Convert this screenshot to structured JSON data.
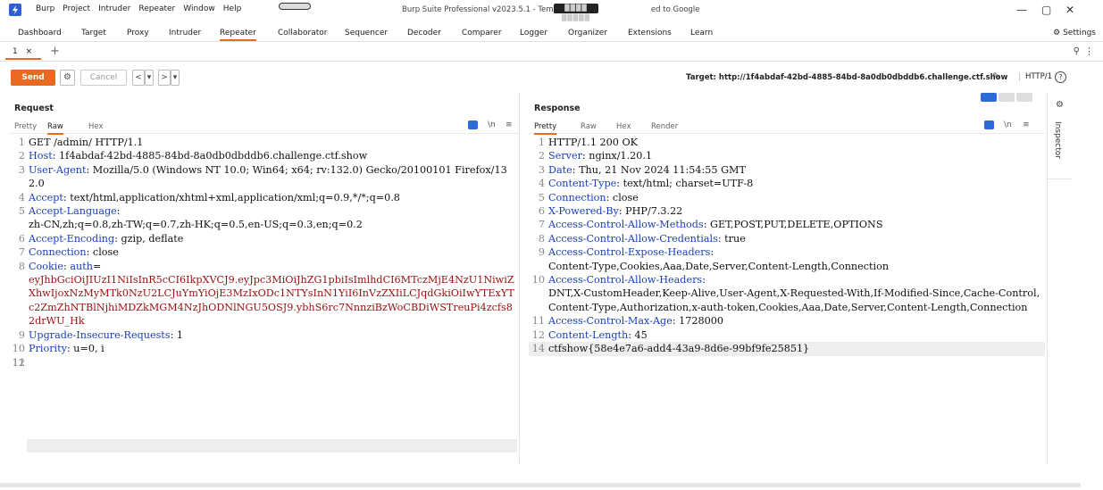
{
  "window": {
    "title": "Burp Suite Professional v2023.5.1 - Temporary Project - licensed to Google",
    "title_visible_left": "Burp Suite Professional v2023.5.1 - Tempora",
    "title_visible_right": "ed to Google",
    "overlay_text": "████ █████",
    "menu": [
      "Burp",
      "Project",
      "Intruder",
      "Repeater",
      "Window",
      "Help"
    ],
    "minimize": "—",
    "maximize": "▢",
    "close": "✕"
  },
  "tool_tabs": [
    "Dashboard",
    "Target",
    "Proxy",
    "Intruder",
    "Repeater",
    "Collaborator",
    "Sequencer",
    "Decoder",
    "Comparer",
    "Logger",
    "Organizer",
    "Extensions",
    "Learn"
  ],
  "active_tool_tab": "Repeater",
  "settings_label": "Settings",
  "repeater_tab": {
    "label": "1",
    "close": "×",
    "add": "+"
  },
  "toolbar": {
    "send": "Send",
    "cancel": "Cancel",
    "back": "<",
    "back_menu": "▾",
    "forward": ">",
    "forward_menu": "▾",
    "target": "Target: http://1f4abdaf-42bd-4885-84bd-8a0db0dbddb6.challenge.ctf.show",
    "http_version": "HTTP/1",
    "help": "?"
  },
  "request": {
    "title": "Request",
    "tabs": [
      "Pretty",
      "Raw",
      "Hex"
    ],
    "active_tab": "Raw",
    "ln_label": "\\n",
    "menu": "≡"
  },
  "response": {
    "title": "Response",
    "tabs": [
      "Pretty",
      "Raw",
      "Hex",
      "Render"
    ],
    "active_tab": "Pretty",
    "ln_label": "\\n",
    "menu": "≡"
  },
  "inspector": {
    "label": "Inspector"
  },
  "colors": {
    "accent": "#e8691f",
    "blue": "#2d6ad6",
    "header_key": "#1a3fb6",
    "cookie": "#9b1010"
  }
}
